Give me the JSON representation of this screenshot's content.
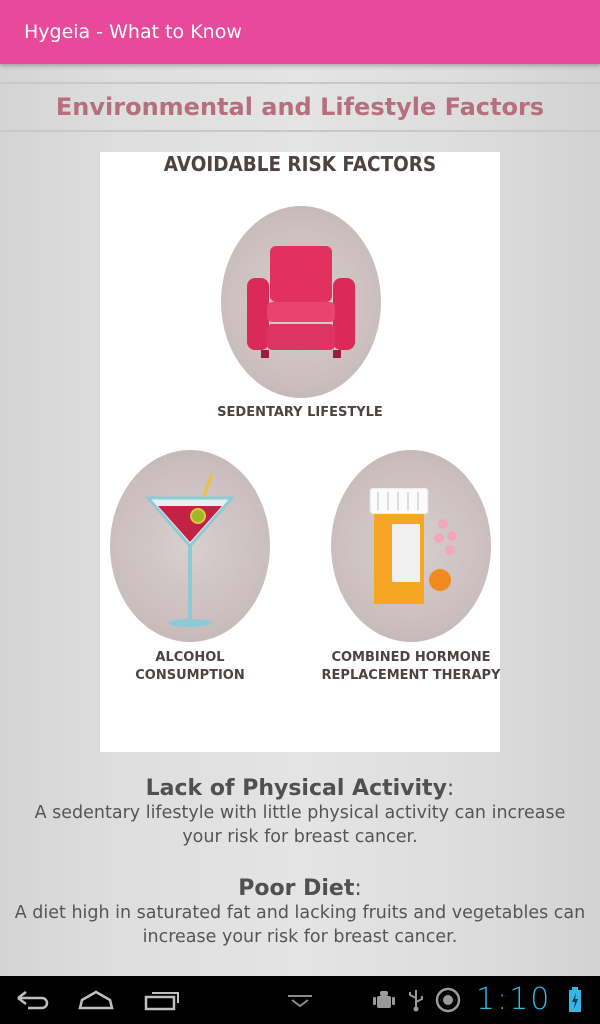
{
  "app": {
    "title": "Hygeia - What to Know"
  },
  "section": {
    "title": "Environmental and Lifestyle Factors"
  },
  "infographic": {
    "title": "AVOIDABLE RISK FACTORS",
    "items": [
      {
        "label": "SEDENTARY LIFESTYLE",
        "icon": "armchair-icon"
      },
      {
        "label": "ALCOHOL CONSUMPTION",
        "icon": "martini-glass-icon"
      },
      {
        "label_line1": "COMBINED HORMONE",
        "label_line2": "REPLACEMENT THERAPY",
        "icon": "pill-bottle-icon"
      }
    ]
  },
  "factors": [
    {
      "heading": "Lack of Physical Activity",
      "colon": ":",
      "body": "A sedentary lifestyle with little physical activity can increase your risk for breast cancer."
    },
    {
      "heading": "Poor Diet",
      "colon": ":",
      "body": "A diet high in saturated fat and lacking fruits and vegetables can increase your risk for breast cancer."
    }
  ],
  "system_bar": {
    "clock": "1:10",
    "accent_color": "#34b5e5",
    "icons": [
      "back-icon",
      "home-icon",
      "recent-apps-icon",
      "keyboard-hide-icon",
      "android-debug-icon",
      "usb-icon",
      "sync-icon",
      "battery-icon"
    ]
  },
  "colors": {
    "appbar": "#e8499a",
    "section_title": "#b56f7e"
  }
}
